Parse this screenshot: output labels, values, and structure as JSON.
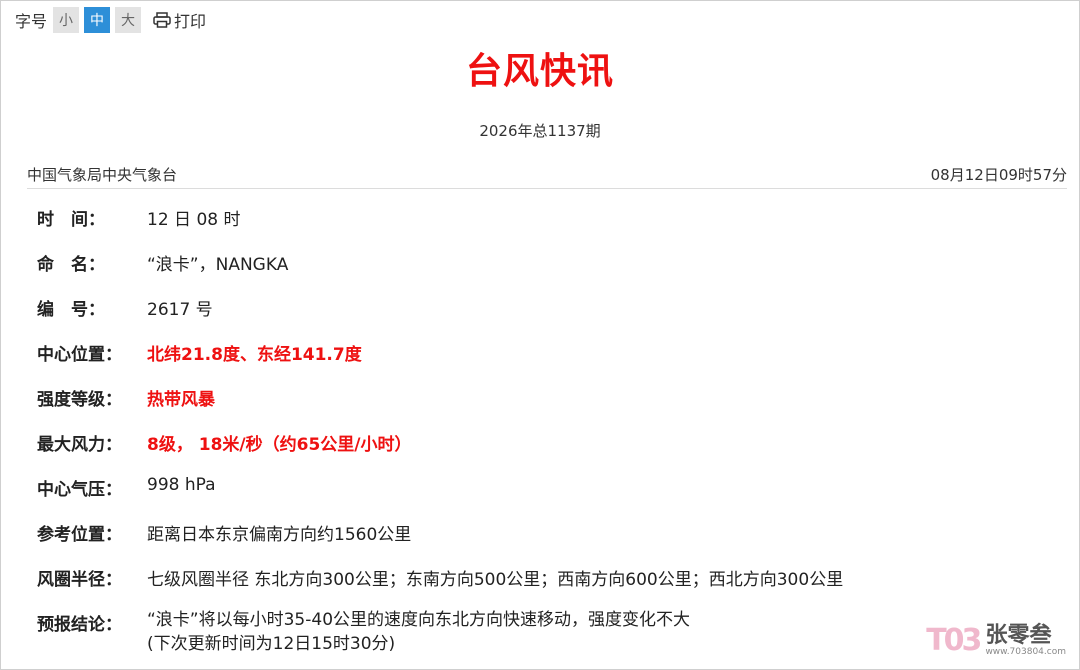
{
  "toolbar": {
    "size_label": "字号",
    "sizes": [
      "小",
      "中",
      "大"
    ],
    "print_label": "打印"
  },
  "title": "台风快讯",
  "issue": "2026年总1137期",
  "source": "中国气象局中央气象台",
  "publish_time": "08月12日09时57分",
  "fields": [
    {
      "label": "时　间：",
      "value": "12 日 08 时"
    },
    {
      "label": "命　名：",
      "value": "“浪卡”，NANGKA"
    },
    {
      "label": "编　号：",
      "value": "2617 号"
    },
    {
      "label": "中心位置：",
      "value": "北纬21.8度、东经141.7度"
    },
    {
      "label": "强度等级：",
      "value": "热带风暴"
    },
    {
      "label": "最大风力：",
      "value": "8级， 18米/秒（约65公里/小时）"
    },
    {
      "label": "中心气压：",
      "value": "998 hPa"
    },
    {
      "label": "参考位置：",
      "value": "距离日本东京偏南方向约1560公里"
    },
    {
      "label": "风圈半径：",
      "value": "七级风圈半径 东北方向300公里；东南方向500公里；西南方向600公里；西北方向300公里"
    },
    {
      "label": "预报结论：",
      "value": "“浪卡”将以每小时35-40公里的速度向东北方向快速移动，强度变化不大",
      "value2": "(下次更新时间为12日15时30分)"
    }
  ],
  "watermark": {
    "logo": "T03",
    "name": "张零叁",
    "url": "www.703804.com"
  },
  "colors": {
    "accent": "#ee1111",
    "button_active": "#2d8fd8"
  }
}
